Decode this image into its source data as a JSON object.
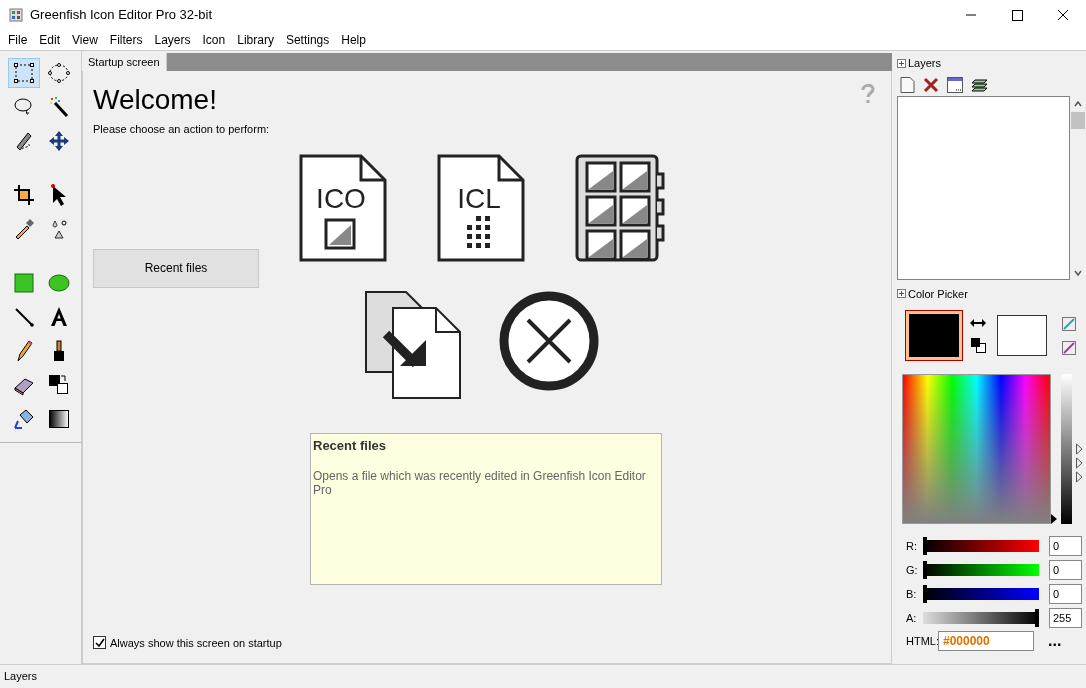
{
  "window": {
    "title": "Greenfish Icon Editor Pro 32-bit"
  },
  "menu": [
    "File",
    "Edit",
    "View",
    "Filters",
    "Layers",
    "Icon",
    "Library",
    "Settings",
    "Help"
  ],
  "tools": [
    {
      "kind": "rect-select",
      "selected": true
    },
    {
      "kind": "ellipse-select",
      "selected": false
    },
    {
      "kind": "lasso",
      "selected": false
    },
    {
      "kind": "wand",
      "selected": false
    },
    {
      "kind": "freehand",
      "selected": false
    },
    {
      "kind": "move",
      "selected": false
    },
    {
      "kind": "crop",
      "selected": false
    },
    {
      "kind": "pointer",
      "selected": false
    },
    {
      "kind": "picker",
      "selected": false
    },
    {
      "kind": "effects",
      "selected": false
    },
    {
      "kind": "rectangle",
      "selected": false
    },
    {
      "kind": "ellipse",
      "selected": false
    },
    {
      "kind": "line",
      "selected": false
    },
    {
      "kind": "text",
      "selected": false
    },
    {
      "kind": "pencil",
      "selected": false
    },
    {
      "kind": "brush",
      "selected": false
    },
    {
      "kind": "eraser",
      "selected": false
    },
    {
      "kind": "swap",
      "selected": false
    },
    {
      "kind": "fill",
      "selected": false
    },
    {
      "kind": "gradient",
      "selected": false
    }
  ],
  "tabs": [
    {
      "label": "Startup screen",
      "selected": true
    }
  ],
  "startup": {
    "heading": "Welcome!",
    "prompt": "Please choose an action to perform:",
    "actions": [
      {
        "kind": "ico",
        "label": "ICO"
      },
      {
        "kind": "icl",
        "label": "ICL"
      },
      {
        "kind": "library"
      },
      {
        "kind": "import"
      },
      {
        "kind": "close"
      }
    ],
    "recent_button": "Recent files",
    "info": {
      "title": "Recent files",
      "description": "Opens a file which was recently edited in Greenfish Icon Editor Pro"
    },
    "always_show": {
      "label": "Always show this screen on startup",
      "checked": true
    }
  },
  "layers_panel": {
    "title": "Layers"
  },
  "color_picker": {
    "title": "Color Picker",
    "channels": [
      {
        "label": "R:",
        "value": "0",
        "level": 0
      },
      {
        "label": "G:",
        "value": "0",
        "level": 0
      },
      {
        "label": "B:",
        "value": "0",
        "level": 0
      },
      {
        "label": "A:",
        "value": "255",
        "level": 1
      }
    ],
    "html_label": "HTML:",
    "html_value": "#000000",
    "more": "..."
  },
  "status_bar": "Layers"
}
